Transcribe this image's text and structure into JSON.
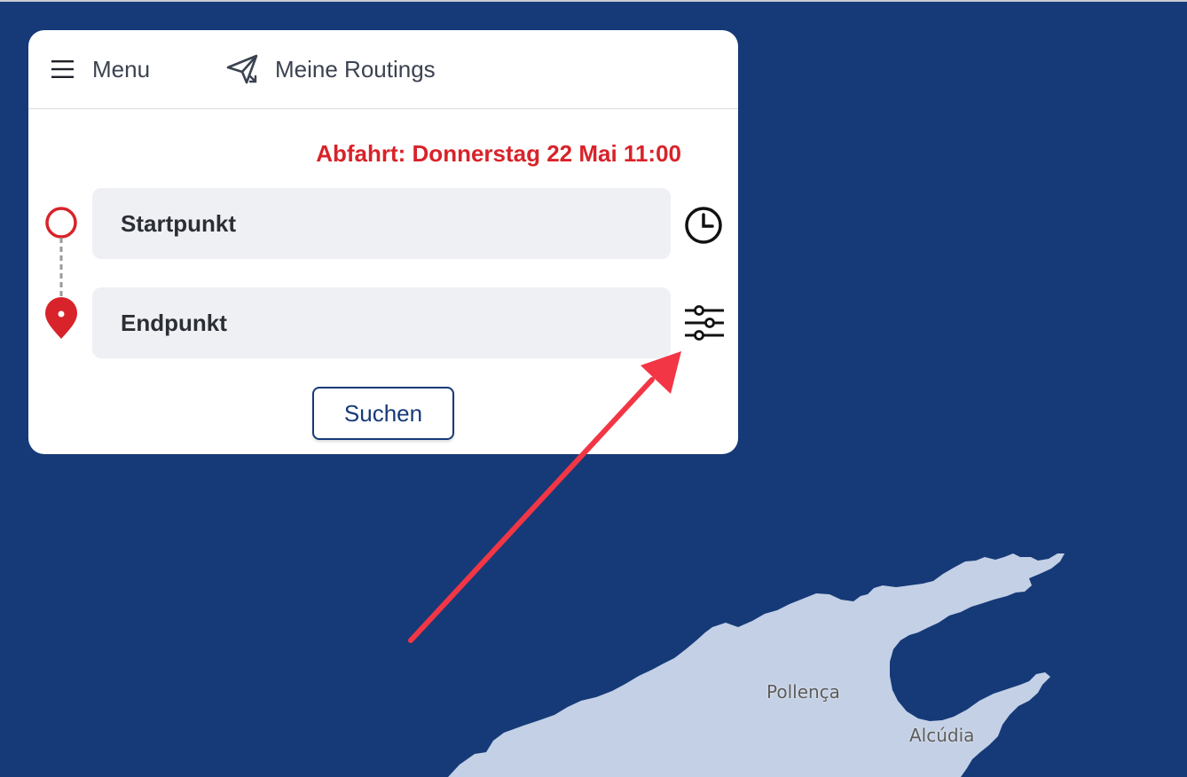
{
  "header": {
    "menu_label": "Menu",
    "routings_label": "Meine Routings"
  },
  "departure": {
    "text": "Abfahrt: Donnerstag 22 Mai 11:00",
    "color": "#d8232a"
  },
  "route": {
    "start_placeholder": "Startpunkt",
    "end_placeholder": "Endpunkt"
  },
  "actions": {
    "search_label": "Suchen"
  },
  "icons": {
    "menu": "hamburger-icon",
    "routings": "send-route-icon",
    "start": "start-circle-icon",
    "end": "map-pin-icon",
    "time": "clock-icon",
    "filters": "sliders-icon"
  },
  "map": {
    "labels": [
      "Pollença",
      "Alcúdia"
    ],
    "sea_color": "#163a78",
    "land_color": "#c3d0e6"
  },
  "colors": {
    "accent": "#163a78",
    "alert": "#d8232a",
    "annotation_arrow": "#f23645"
  }
}
